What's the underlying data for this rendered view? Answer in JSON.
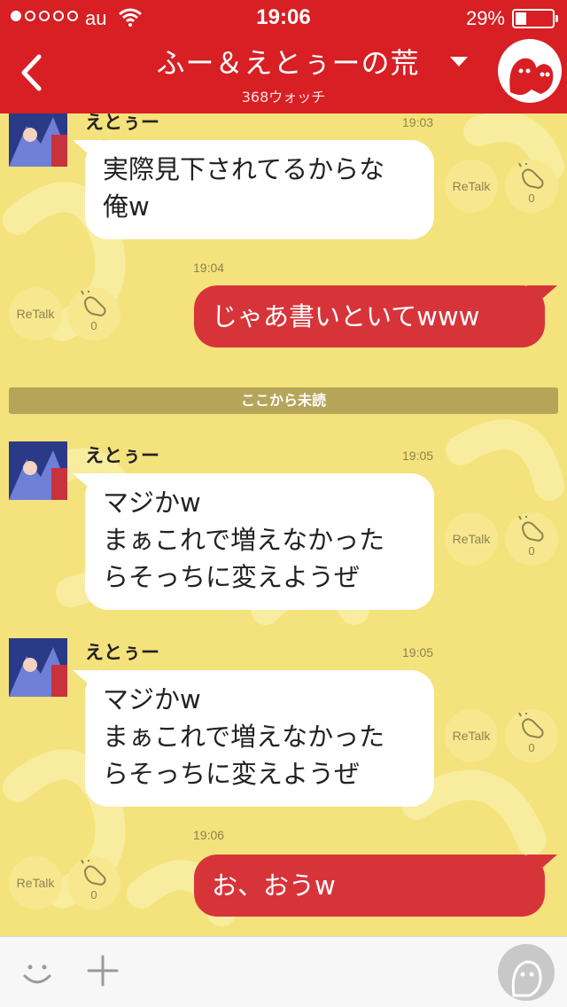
{
  "status_bar": {
    "carrier": "au",
    "time": "19:06",
    "battery": "29%",
    "battery_level": 0.29,
    "signal_bars_filled": 1,
    "signal_bars_total": 5
  },
  "header": {
    "title": "ふー＆えとぅーの荒",
    "subtitle": "368ウォッチ",
    "accent_color": "#d71f24"
  },
  "chat": {
    "background_color": "#f4e27c",
    "unread_divider": "ここから未読",
    "retalk_label": "ReTalk",
    "messages": [
      {
        "from": "other",
        "name": "えとぅー",
        "time": "19:03",
        "text": "実際見下されてるからな\n俺w",
        "claps": "0"
      },
      {
        "from": "me",
        "time": "19:04",
        "text": "じゃあ書いといてwww",
        "claps": "0"
      },
      {
        "from": "other",
        "name": "えとぅー",
        "time": "19:05",
        "text": "マジかw\nまぁこれで増えなかった\nらそっちに変えようぜ",
        "claps": "0"
      },
      {
        "from": "other",
        "name": "えとぅー",
        "time": "19:05",
        "text": "マジかw\nまぁこれで増えなかった\nらそっちに変えようぜ",
        "claps": "0"
      },
      {
        "from": "me",
        "time": "19:06",
        "text": "お、おうw",
        "claps": "0"
      }
    ]
  },
  "icons": {
    "back": "chevron-left-icon",
    "dropdown": "caret-down-icon",
    "mascot": "ghost-mascot-icon",
    "clap": "clap-hands-icon",
    "emoji": "smile-icon",
    "add": "plus-icon",
    "voice": "ghost-avatar-icon"
  }
}
